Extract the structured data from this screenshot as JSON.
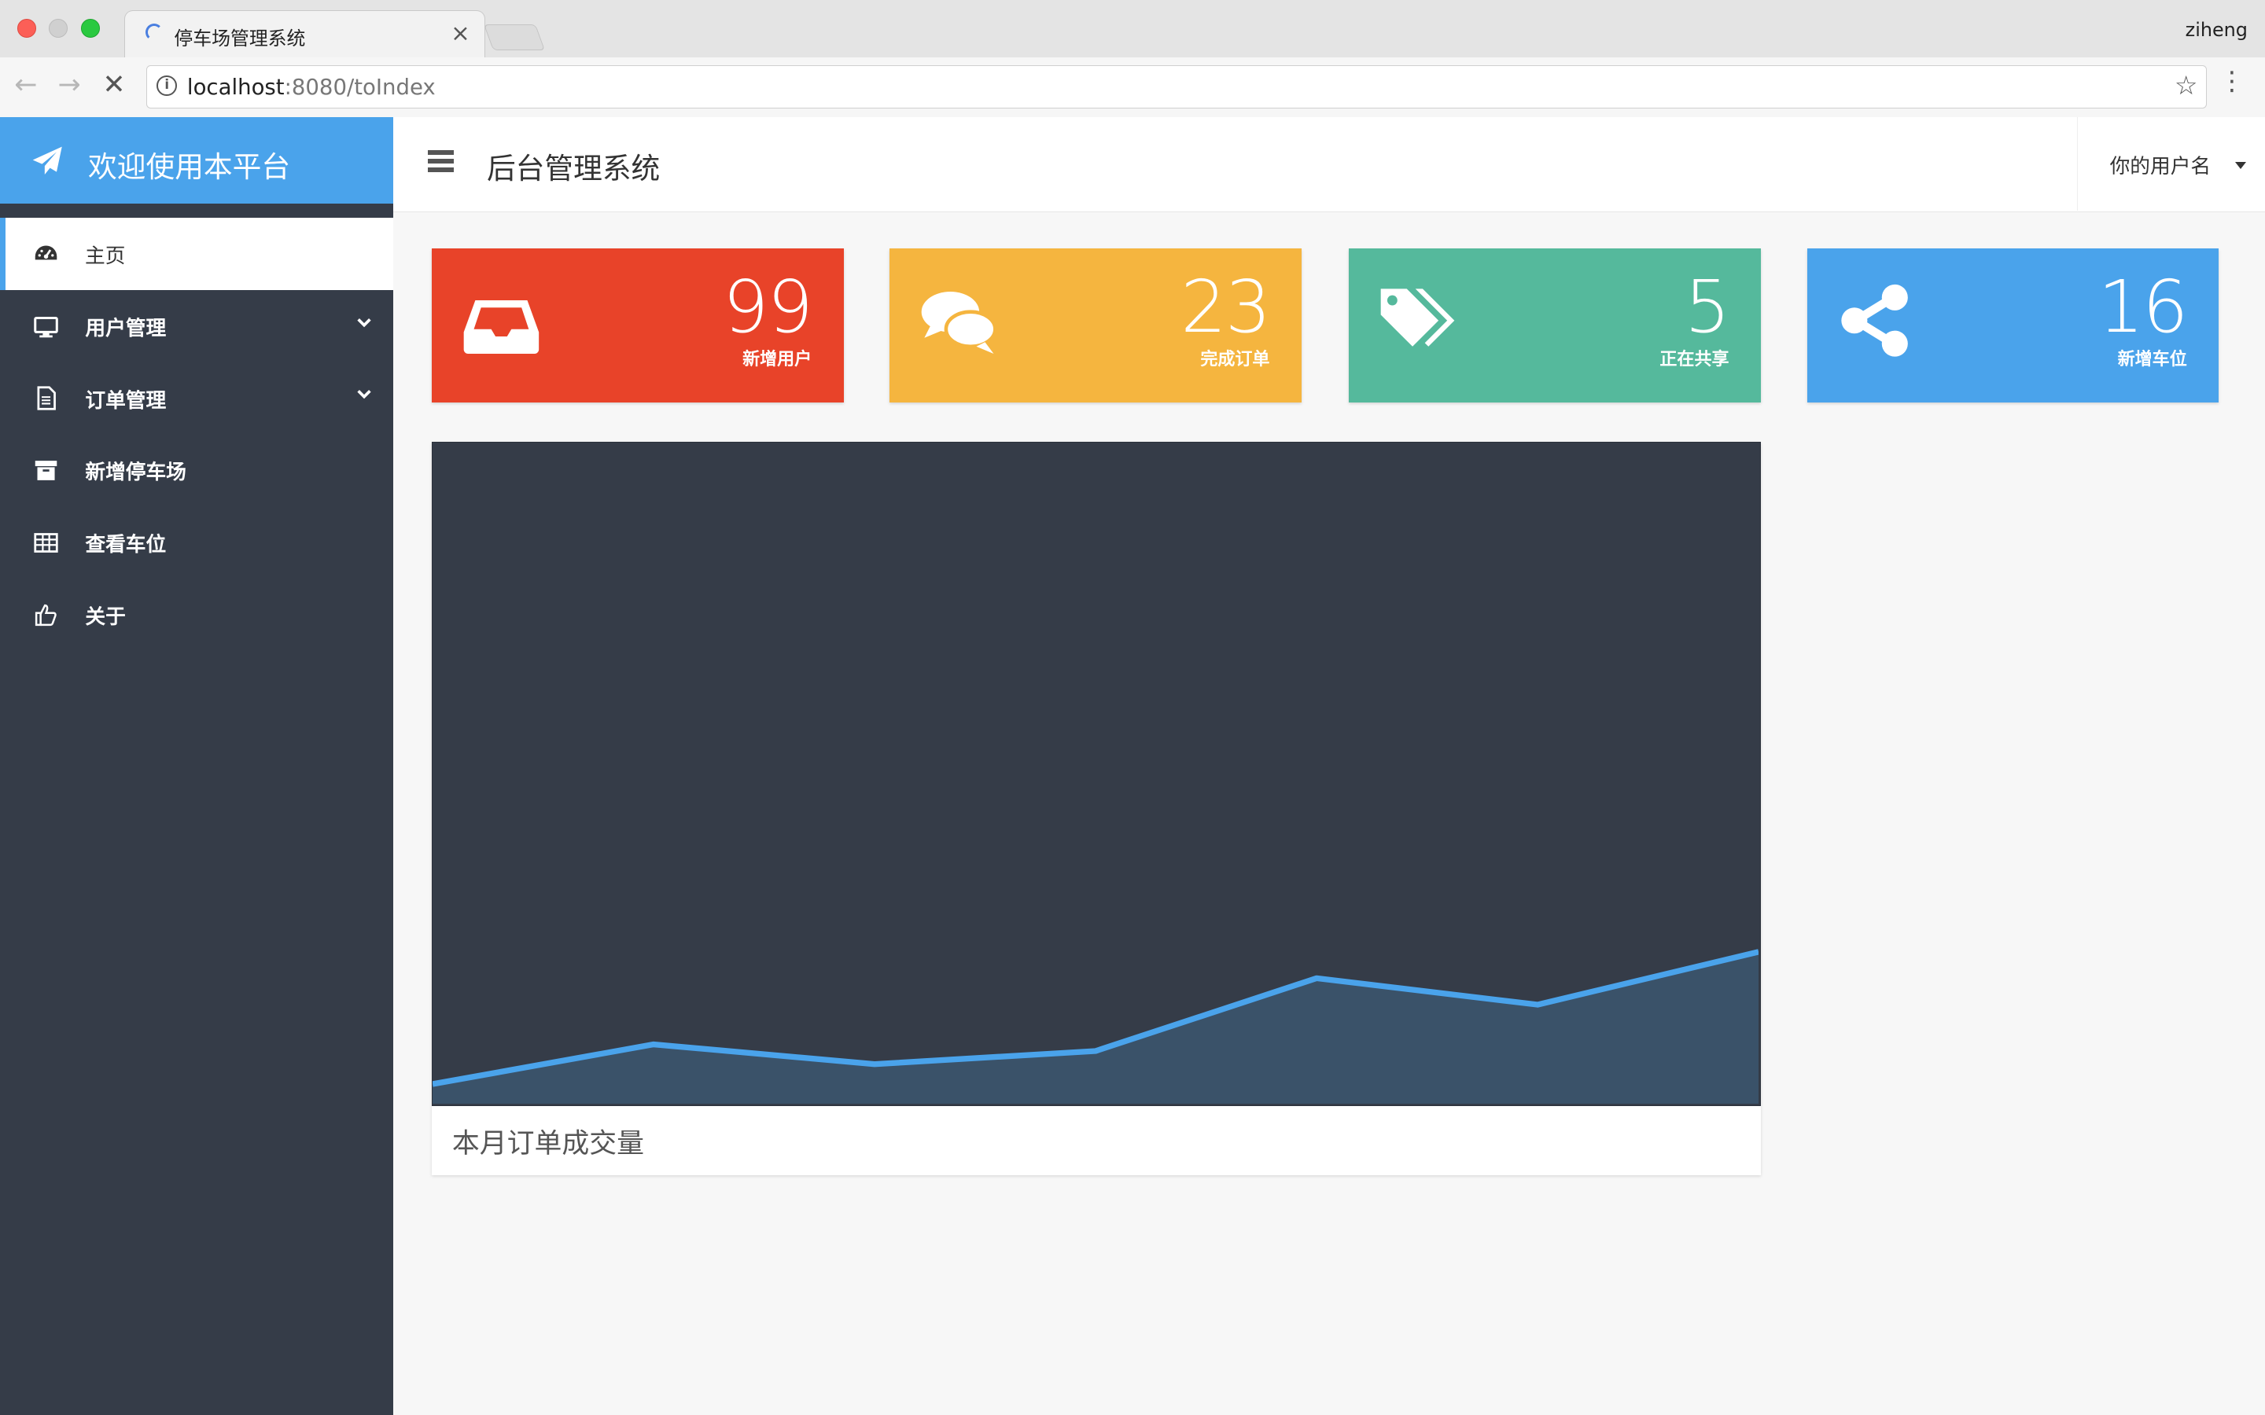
{
  "browser": {
    "tab_title": "停车场管理系统",
    "tab_close": "×",
    "profile_name": "ziheng",
    "url_host": "localhost",
    "url_rest": ":8080/toIndex"
  },
  "sidebar": {
    "brand": "欢迎使用本平台",
    "items": [
      {
        "label": "主页",
        "icon": "dashboard-icon",
        "active": true
      },
      {
        "label": "用户管理",
        "icon": "desktop-icon",
        "expandable": true
      },
      {
        "label": "订单管理",
        "icon": "file-icon",
        "expandable": true
      },
      {
        "label": "新增停车场",
        "icon": "archive-icon"
      },
      {
        "label": "查看车位",
        "icon": "table-icon"
      },
      {
        "label": "关于",
        "icon": "thumbs-up-icon"
      }
    ]
  },
  "header": {
    "title": "后台管理系统",
    "user": "你的用户名"
  },
  "cards": [
    {
      "value": "99",
      "label": "新增用户",
      "icon": "inbox-icon",
      "color": "#e84329"
    },
    {
      "value": "23",
      "label": "完成订单",
      "icon": "comments-icon",
      "color": "#f5b53f"
    },
    {
      "value": "5",
      "label": "正在共享",
      "icon": "tags-icon",
      "color": "#55b99c"
    },
    {
      "value": "16",
      "label": "新增车位",
      "icon": "share-icon",
      "color": "#4aa3eb"
    }
  ],
  "colors": {
    "accent": "#4aa3eb",
    "sidebar_bg": "#353c48",
    "chart_line": "#4aa3eb",
    "chart_fill": "#3a5269"
  },
  "chart_data": {
    "type": "area",
    "caption": "本月订单成交量",
    "series": [
      {
        "values": [
          3,
          9,
          6,
          8,
          19,
          15,
          23
        ]
      }
    ],
    "ylim": [
      0,
      100
    ],
    "grid": false
  }
}
